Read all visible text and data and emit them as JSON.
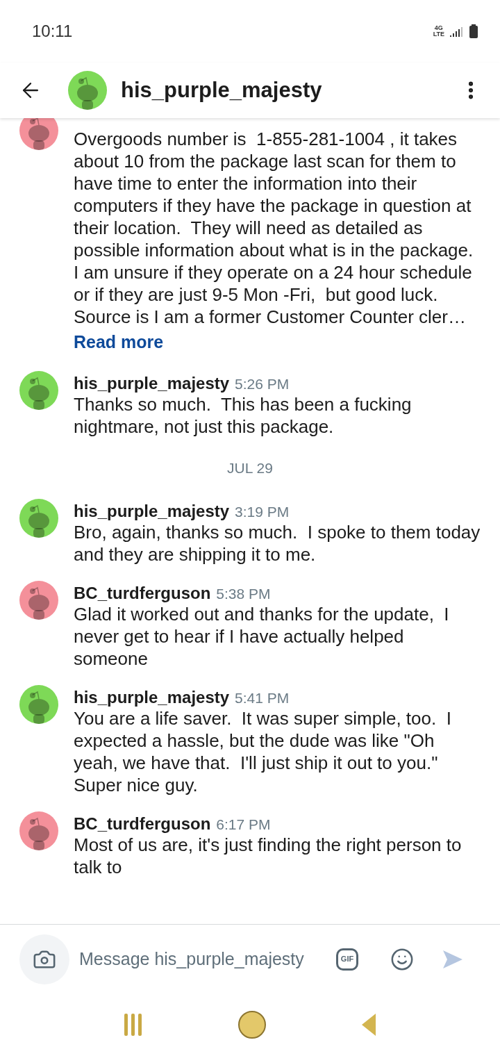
{
  "status_bar": {
    "time": "10:11",
    "network": "4G LTE"
  },
  "header": {
    "title": "his_purple_majesty",
    "color": "#7ed957"
  },
  "messages": [
    {
      "kind": "message",
      "color": "#f4909a",
      "text": "Overgoods number is  1-855-281-1004 , it takes about 10 from the package last scan for them to have time to enter the information into their computers if they have the package in question at their location.  They will need as detailed as possible information about what is in the package. I am unsure if they operate on a 24 hour schedule or if they are just 9-5 Mon -Fri,  but good luck.\nSource is I am a former Customer Counter cler…",
      "read_more": "Read more"
    },
    {
      "kind": "message",
      "author": "his_purple_majesty",
      "time": "5:26 PM",
      "color": "#7ed957",
      "text": "Thanks so much.  This has been a fucking nightmare, not just this package."
    },
    {
      "kind": "date",
      "text": "JUL 29"
    },
    {
      "kind": "message",
      "author": "his_purple_majesty",
      "time": "3:19 PM",
      "color": "#7ed957",
      "text": "Bro, again, thanks so much.  I spoke to them today and they are shipping it to me."
    },
    {
      "kind": "message",
      "author": "BC_turdferguson",
      "time": "5:38 PM",
      "color": "#f4909a",
      "text": "Glad it worked out and thanks for the update,  I never get to hear if I have actually helped someone"
    },
    {
      "kind": "message",
      "author": "his_purple_majesty",
      "time": "5:41 PM",
      "color": "#7ed957",
      "text": "You are a life saver.  It was super simple, too.  I expected a hassle, but the dude was like \"Oh yeah, we have that.  I'll just ship it out to you.\" Super nice guy."
    },
    {
      "kind": "message",
      "author": "BC_turdferguson",
      "time": "6:17 PM",
      "color": "#f4909a",
      "text": "Most of us are, it's just finding the right person to talk to"
    }
  ],
  "composer": {
    "placeholder": "Message his_purple_majesty",
    "gif_label": "GIF"
  }
}
